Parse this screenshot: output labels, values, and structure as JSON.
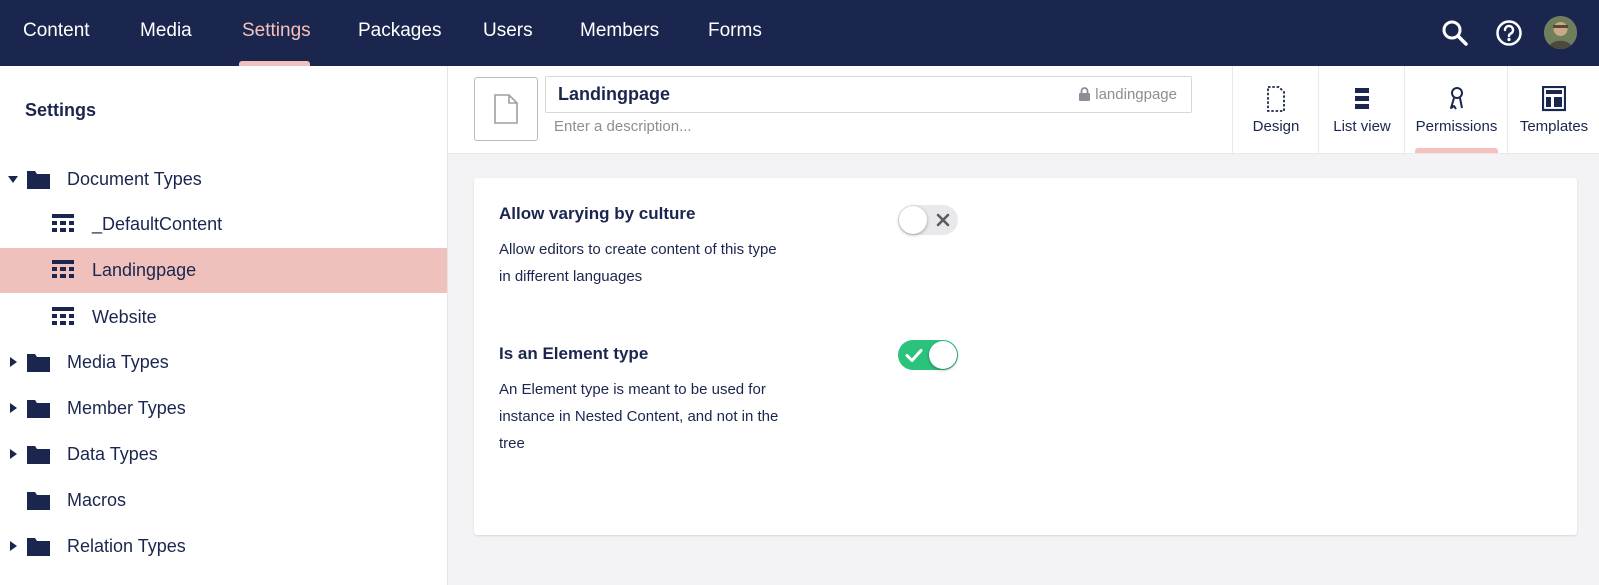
{
  "nav": {
    "items": [
      {
        "label": "Content",
        "active": false
      },
      {
        "label": "Media",
        "active": false
      },
      {
        "label": "Settings",
        "active": true
      },
      {
        "label": "Packages",
        "active": false
      },
      {
        "label": "Users",
        "active": false
      },
      {
        "label": "Members",
        "active": false
      },
      {
        "label": "Forms",
        "active": false
      }
    ],
    "icons": [
      "search-icon",
      "help-icon",
      "avatar"
    ]
  },
  "sidebar": {
    "title": "Settings",
    "tree": [
      {
        "label": "Document Types",
        "icon": "folder-icon",
        "expanded": true
      },
      {
        "label": "_DefaultContent",
        "icon": "doctype-icon",
        "child": true
      },
      {
        "label": "Landingpage",
        "icon": "doctype-icon",
        "child": true,
        "selected": true
      },
      {
        "label": "Website",
        "icon": "doctype-icon",
        "child": true
      },
      {
        "label": "Media Types",
        "icon": "folder-icon",
        "expanded": false
      },
      {
        "label": "Member Types",
        "icon": "folder-icon",
        "expanded": false
      },
      {
        "label": "Data Types",
        "icon": "folder-icon",
        "expanded": false
      },
      {
        "label": "Macros",
        "icon": "folder-icon",
        "expanded": null
      },
      {
        "label": "Relation Types",
        "icon": "folder-icon",
        "expanded": false
      }
    ]
  },
  "editor": {
    "name": "Landingpage",
    "alias": "landingpage",
    "description_placeholder": "Enter a description...",
    "apps": [
      {
        "label": "Design",
        "icon": "design-icon",
        "active": false
      },
      {
        "label": "List view",
        "icon": "list-view-icon",
        "active": false
      },
      {
        "label": "Permissions",
        "icon": "permissions-icon",
        "active": true
      },
      {
        "label": "Templates",
        "icon": "templates-icon",
        "active": false
      }
    ]
  },
  "permissions": {
    "vary_by_culture": {
      "label": "Allow varying by culture",
      "description_line1": "Allow editors to create content of this type",
      "description_line2": "in different languages",
      "enabled": false
    },
    "element_type": {
      "label": "Is an Element type",
      "description_line1": "An Element type is meant to be used for",
      "description_line2": "instance in Nested Content, and not in the",
      "description_line3": "tree",
      "enabled": true
    }
  },
  "colors": {
    "nav_bg": "#1b264f",
    "accent": "#f5c1bc",
    "selected_row": "#f0c1bc",
    "toggle_on": "#2bc37c",
    "toggle_off": "#e9e9eb"
  }
}
